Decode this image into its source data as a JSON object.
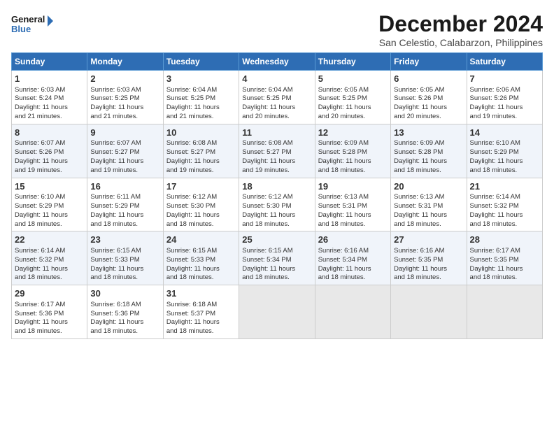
{
  "logo": {
    "line1": "General",
    "line2": "Blue"
  },
  "title": "December 2024",
  "subtitle": "San Celestio, Calabarzon, Philippines",
  "days_of_week": [
    "Sunday",
    "Monday",
    "Tuesday",
    "Wednesday",
    "Thursday",
    "Friday",
    "Saturday"
  ],
  "weeks": [
    [
      {
        "day": "1",
        "sunrise": "Sunrise: 6:03 AM",
        "sunset": "Sunset: 5:24 PM",
        "daylight": "Daylight: 11 hours",
        "extra": "and 21 minutes."
      },
      {
        "day": "2",
        "sunrise": "Sunrise: 6:03 AM",
        "sunset": "Sunset: 5:25 PM",
        "daylight": "Daylight: 11 hours",
        "extra": "and 21 minutes."
      },
      {
        "day": "3",
        "sunrise": "Sunrise: 6:04 AM",
        "sunset": "Sunset: 5:25 PM",
        "daylight": "Daylight: 11 hours",
        "extra": "and 21 minutes."
      },
      {
        "day": "4",
        "sunrise": "Sunrise: 6:04 AM",
        "sunset": "Sunset: 5:25 PM",
        "daylight": "Daylight: 11 hours",
        "extra": "and 20 minutes."
      },
      {
        "day": "5",
        "sunrise": "Sunrise: 6:05 AM",
        "sunset": "Sunset: 5:25 PM",
        "daylight": "Daylight: 11 hours",
        "extra": "and 20 minutes."
      },
      {
        "day": "6",
        "sunrise": "Sunrise: 6:05 AM",
        "sunset": "Sunset: 5:26 PM",
        "daylight": "Daylight: 11 hours",
        "extra": "and 20 minutes."
      },
      {
        "day": "7",
        "sunrise": "Sunrise: 6:06 AM",
        "sunset": "Sunset: 5:26 PM",
        "daylight": "Daylight: 11 hours",
        "extra": "and 19 minutes."
      }
    ],
    [
      {
        "day": "8",
        "sunrise": "Sunrise: 6:07 AM",
        "sunset": "Sunset: 5:26 PM",
        "daylight": "Daylight: 11 hours",
        "extra": "and 19 minutes."
      },
      {
        "day": "9",
        "sunrise": "Sunrise: 6:07 AM",
        "sunset": "Sunset: 5:27 PM",
        "daylight": "Daylight: 11 hours",
        "extra": "and 19 minutes."
      },
      {
        "day": "10",
        "sunrise": "Sunrise: 6:08 AM",
        "sunset": "Sunset: 5:27 PM",
        "daylight": "Daylight: 11 hours",
        "extra": "and 19 minutes."
      },
      {
        "day": "11",
        "sunrise": "Sunrise: 6:08 AM",
        "sunset": "Sunset: 5:27 PM",
        "daylight": "Daylight: 11 hours",
        "extra": "and 19 minutes."
      },
      {
        "day": "12",
        "sunrise": "Sunrise: 6:09 AM",
        "sunset": "Sunset: 5:28 PM",
        "daylight": "Daylight: 11 hours",
        "extra": "and 18 minutes."
      },
      {
        "day": "13",
        "sunrise": "Sunrise: 6:09 AM",
        "sunset": "Sunset: 5:28 PM",
        "daylight": "Daylight: 11 hours",
        "extra": "and 18 minutes."
      },
      {
        "day": "14",
        "sunrise": "Sunrise: 6:10 AM",
        "sunset": "Sunset: 5:29 PM",
        "daylight": "Daylight: 11 hours",
        "extra": "and 18 minutes."
      }
    ],
    [
      {
        "day": "15",
        "sunrise": "Sunrise: 6:10 AM",
        "sunset": "Sunset: 5:29 PM",
        "daylight": "Daylight: 11 hours",
        "extra": "and 18 minutes."
      },
      {
        "day": "16",
        "sunrise": "Sunrise: 6:11 AM",
        "sunset": "Sunset: 5:29 PM",
        "daylight": "Daylight: 11 hours",
        "extra": "and 18 minutes."
      },
      {
        "day": "17",
        "sunrise": "Sunrise: 6:12 AM",
        "sunset": "Sunset: 5:30 PM",
        "daylight": "Daylight: 11 hours",
        "extra": "and 18 minutes."
      },
      {
        "day": "18",
        "sunrise": "Sunrise: 6:12 AM",
        "sunset": "Sunset: 5:30 PM",
        "daylight": "Daylight: 11 hours",
        "extra": "and 18 minutes."
      },
      {
        "day": "19",
        "sunrise": "Sunrise: 6:13 AM",
        "sunset": "Sunset: 5:31 PM",
        "daylight": "Daylight: 11 hours",
        "extra": "and 18 minutes."
      },
      {
        "day": "20",
        "sunrise": "Sunrise: 6:13 AM",
        "sunset": "Sunset: 5:31 PM",
        "daylight": "Daylight: 11 hours",
        "extra": "and 18 minutes."
      },
      {
        "day": "21",
        "sunrise": "Sunrise: 6:14 AM",
        "sunset": "Sunset: 5:32 PM",
        "daylight": "Daylight: 11 hours",
        "extra": "and 18 minutes."
      }
    ],
    [
      {
        "day": "22",
        "sunrise": "Sunrise: 6:14 AM",
        "sunset": "Sunset: 5:32 PM",
        "daylight": "Daylight: 11 hours",
        "extra": "and 18 minutes."
      },
      {
        "day": "23",
        "sunrise": "Sunrise: 6:15 AM",
        "sunset": "Sunset: 5:33 PM",
        "daylight": "Daylight: 11 hours",
        "extra": "and 18 minutes."
      },
      {
        "day": "24",
        "sunrise": "Sunrise: 6:15 AM",
        "sunset": "Sunset: 5:33 PM",
        "daylight": "Daylight: 11 hours",
        "extra": "and 18 minutes."
      },
      {
        "day": "25",
        "sunrise": "Sunrise: 6:15 AM",
        "sunset": "Sunset: 5:34 PM",
        "daylight": "Daylight: 11 hours",
        "extra": "and 18 minutes."
      },
      {
        "day": "26",
        "sunrise": "Sunrise: 6:16 AM",
        "sunset": "Sunset: 5:34 PM",
        "daylight": "Daylight: 11 hours",
        "extra": "and 18 minutes."
      },
      {
        "day": "27",
        "sunrise": "Sunrise: 6:16 AM",
        "sunset": "Sunset: 5:35 PM",
        "daylight": "Daylight: 11 hours",
        "extra": "and 18 minutes."
      },
      {
        "day": "28",
        "sunrise": "Sunrise: 6:17 AM",
        "sunset": "Sunset: 5:35 PM",
        "daylight": "Daylight: 11 hours",
        "extra": "and 18 minutes."
      }
    ],
    [
      {
        "day": "29",
        "sunrise": "Sunrise: 6:17 AM",
        "sunset": "Sunset: 5:36 PM",
        "daylight": "Daylight: 11 hours",
        "extra": "and 18 minutes."
      },
      {
        "day": "30",
        "sunrise": "Sunrise: 6:18 AM",
        "sunset": "Sunset: 5:36 PM",
        "daylight": "Daylight: 11 hours",
        "extra": "and 18 minutes."
      },
      {
        "day": "31",
        "sunrise": "Sunrise: 6:18 AM",
        "sunset": "Sunset: 5:37 PM",
        "daylight": "Daylight: 11 hours",
        "extra": "and 18 minutes."
      },
      null,
      null,
      null,
      null
    ]
  ]
}
